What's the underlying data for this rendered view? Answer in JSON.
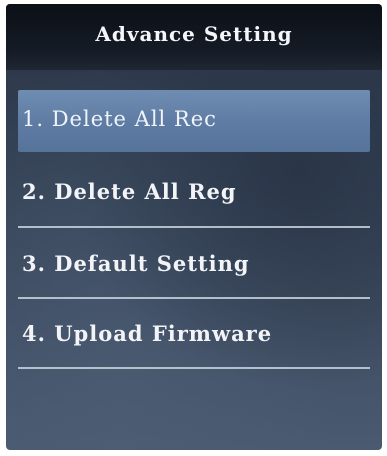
{
  "screen": {
    "title": "Advance Setting"
  },
  "menu": {
    "items": [
      {
        "label": "1. Delete All Rec",
        "selected": true
      },
      {
        "label": "2. Delete All Reg",
        "selected": false
      },
      {
        "label": "3. Default Setting",
        "selected": false
      },
      {
        "label": "4. Upload Firmware",
        "selected": false
      }
    ]
  },
  "colors": {
    "title_bar": "#0b0f16",
    "selected_highlight": "#6f8db2",
    "screen_background": "#344154",
    "text": "#f2f4f8",
    "divider": "#c9d3df"
  }
}
